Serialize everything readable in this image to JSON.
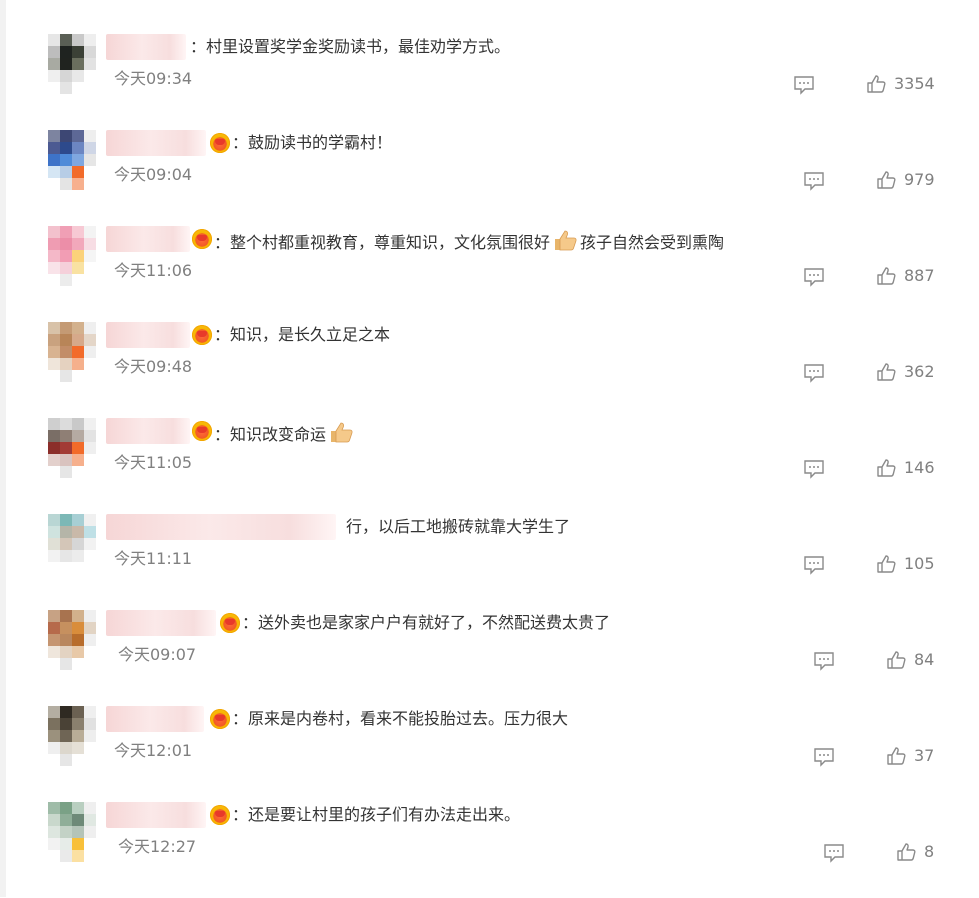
{
  "colors": {
    "text": "#333333",
    "muted": "#808080",
    "icon": "#8a8a8a",
    "crown": "#f15a24"
  },
  "comments": [
    {
      "text": "：村里设置奖学金奖励读书，最佳劝学方式。",
      "time": "今天09:34",
      "likes": "3354",
      "has_crown": false,
      "emoji": ""
    },
    {
      "text": "：鼓励读书的学霸村！",
      "time": "今天09:04",
      "likes": "979",
      "has_crown": true,
      "emoji": ""
    },
    {
      "text": "：整个村都重视教育，尊重知识，文化氛围很好",
      "text_after": "孩子自然会受到熏陶",
      "time": "今天11:06",
      "likes": "887",
      "has_crown": true,
      "emoji": "thumbs-up-emoji"
    },
    {
      "text": "：知识，是长久立足之本",
      "time": "今天09:48",
      "likes": "362",
      "has_crown": true,
      "emoji": ""
    },
    {
      "text": "：知识改变命运",
      "time": "今天11:05",
      "likes": "146",
      "has_crown": true,
      "emoji": "thumbs-up-emoji"
    },
    {
      "text": "行，以后工地搬砖就靠大学生了",
      "time": "今天11:11",
      "likes": "105",
      "has_crown": false,
      "emoji": ""
    },
    {
      "text": "：送外卖也是家家户户有就好了，不然配送费太贵了",
      "time": "今天09:07",
      "likes": "84",
      "has_crown": true,
      "emoji": ""
    },
    {
      "text": "：原来是内卷村，看来不能投胎过去。压力很大",
      "time": "今天12:01",
      "likes": "37",
      "has_crown": true,
      "emoji": ""
    },
    {
      "text": "：还是要让村里的孩子们有办法走出来。",
      "time": "今天12:27",
      "likes": "8",
      "has_crown": true,
      "emoji": ""
    }
  ]
}
